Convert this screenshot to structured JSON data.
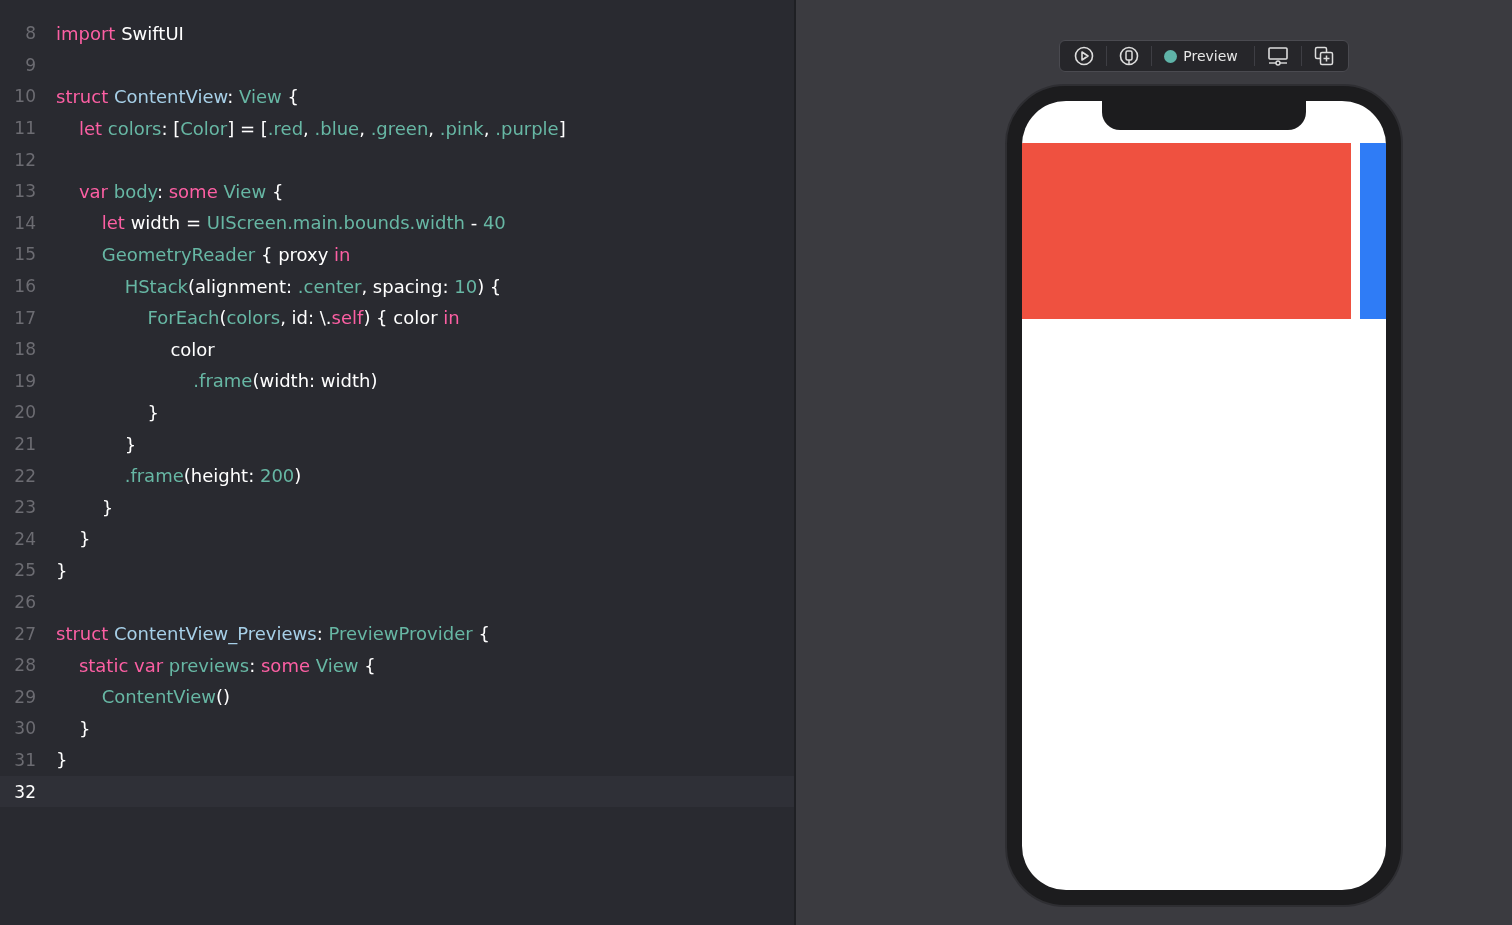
{
  "editor": {
    "lines": [
      {
        "number": "8",
        "current": false,
        "tokens": [
          {
            "kind": "keyword",
            "text": "import"
          },
          {
            "kind": "plain",
            "text": " SwiftUI"
          }
        ]
      },
      {
        "number": "9",
        "current": false
      },
      {
        "number": "10",
        "current": false,
        "tokens": [
          {
            "kind": "keyword",
            "text": "struct "
          },
          {
            "kind": "decl",
            "text": "ContentView"
          },
          {
            "kind": "plain",
            "text": ": "
          },
          {
            "kind": "type",
            "text": "View"
          },
          {
            "kind": "plain",
            "text": " {"
          }
        ]
      },
      {
        "number": "11",
        "current": false,
        "tokens": [
          {
            "kind": "keyword",
            "text": "    let "
          },
          {
            "kind": "type",
            "text": "colors"
          },
          {
            "kind": "plain",
            "text": ": ["
          },
          {
            "kind": "type",
            "text": "Color"
          },
          {
            "kind": "plain",
            "text": "] = ["
          },
          {
            "kind": "type",
            "text": ".red"
          },
          {
            "kind": "plain",
            "text": ", "
          },
          {
            "kind": "type",
            "text": ".blue"
          },
          {
            "kind": "plain",
            "text": ", "
          },
          {
            "kind": "type",
            "text": ".green"
          },
          {
            "kind": "plain",
            "text": ", "
          },
          {
            "kind": "type",
            "text": ".pink"
          },
          {
            "kind": "plain",
            "text": ", "
          },
          {
            "kind": "type",
            "text": ".purple"
          },
          {
            "kind": "plain",
            "text": "]"
          }
        ]
      },
      {
        "number": "12",
        "current": false
      },
      {
        "number": "13",
        "current": false,
        "tokens": [
          {
            "kind": "keyword",
            "text": "    var "
          },
          {
            "kind": "type",
            "text": "body"
          },
          {
            "kind": "plain",
            "text": ": "
          },
          {
            "kind": "keyword",
            "text": "some "
          },
          {
            "kind": "type",
            "text": "View"
          },
          {
            "kind": "plain",
            "text": " {"
          }
        ]
      },
      {
        "number": "14",
        "current": false,
        "tokens": [
          {
            "kind": "keyword",
            "text": "        let"
          },
          {
            "kind": "plain",
            "text": " width = "
          },
          {
            "kind": "type",
            "text": "UIScreen.main.bounds.width"
          },
          {
            "kind": "plain",
            "text": " - "
          },
          {
            "kind": "number",
            "text": "40"
          }
        ]
      },
      {
        "number": "15",
        "current": false,
        "tokens": [
          {
            "kind": "type",
            "text": "        GeometryReader"
          },
          {
            "kind": "plain",
            "text": " { proxy "
          },
          {
            "kind": "keyword",
            "text": "in"
          }
        ]
      },
      {
        "number": "16",
        "current": false,
        "tokens": [
          {
            "kind": "type",
            "text": "            HStack"
          },
          {
            "kind": "plain",
            "text": "(alignment: "
          },
          {
            "kind": "type",
            "text": ".center"
          },
          {
            "kind": "plain",
            "text": ", spacing: "
          },
          {
            "kind": "number",
            "text": "10"
          },
          {
            "kind": "plain",
            "text": ") {"
          }
        ]
      },
      {
        "number": "17",
        "current": false,
        "tokens": [
          {
            "kind": "type",
            "text": "                ForEach"
          },
          {
            "kind": "plain",
            "text": "("
          },
          {
            "kind": "type",
            "text": "colors"
          },
          {
            "kind": "plain",
            "text": ", id: \\."
          },
          {
            "kind": "keyword",
            "text": "self"
          },
          {
            "kind": "plain",
            "text": ") { color "
          },
          {
            "kind": "keyword",
            "text": "in"
          }
        ]
      },
      {
        "number": "18",
        "current": false,
        "tokens": [
          {
            "kind": "plain",
            "text": "                    color"
          }
        ]
      },
      {
        "number": "19",
        "current": false,
        "tokens": [
          {
            "kind": "type",
            "text": "                        .frame"
          },
          {
            "kind": "plain",
            "text": "(width: width)"
          }
        ]
      },
      {
        "number": "20",
        "current": false,
        "tokens": [
          {
            "kind": "plain",
            "text": "                }"
          }
        ]
      },
      {
        "number": "21",
        "current": false,
        "tokens": [
          {
            "kind": "plain",
            "text": "            }"
          }
        ]
      },
      {
        "number": "22",
        "current": false,
        "tokens": [
          {
            "kind": "type",
            "text": "            .frame"
          },
          {
            "kind": "plain",
            "text": "(height: "
          },
          {
            "kind": "number",
            "text": "200"
          },
          {
            "kind": "plain",
            "text": ")"
          }
        ]
      },
      {
        "number": "23",
        "current": false,
        "tokens": [
          {
            "kind": "plain",
            "text": "        }"
          }
        ]
      },
      {
        "number": "24",
        "current": false,
        "tokens": [
          {
            "kind": "plain",
            "text": "    }"
          }
        ]
      },
      {
        "number": "25",
        "current": false,
        "tokens": [
          {
            "kind": "plain",
            "text": "}"
          }
        ]
      },
      {
        "number": "26",
        "current": false
      },
      {
        "number": "27",
        "current": false,
        "tokens": [
          {
            "kind": "keyword",
            "text": "struct "
          },
          {
            "kind": "decl",
            "text": "ContentView_Previews"
          },
          {
            "kind": "plain",
            "text": ": "
          },
          {
            "kind": "type",
            "text": "PreviewProvider"
          },
          {
            "kind": "plain",
            "text": " {"
          }
        ]
      },
      {
        "number": "28",
        "current": false,
        "tokens": [
          {
            "kind": "keyword",
            "text": "    static var "
          },
          {
            "kind": "type",
            "text": "previews"
          },
          {
            "kind": "plain",
            "text": ": "
          },
          {
            "kind": "keyword",
            "text": "some "
          },
          {
            "kind": "type",
            "text": "View"
          },
          {
            "kind": "plain",
            "text": " {"
          }
        ]
      },
      {
        "number": "29",
        "current": false,
        "tokens": [
          {
            "kind": "type",
            "text": "        ContentView"
          },
          {
            "kind": "plain",
            "text": "()"
          }
        ]
      },
      {
        "number": "30",
        "current": false,
        "tokens": [
          {
            "kind": "plain",
            "text": "    }"
          }
        ]
      },
      {
        "number": "31",
        "current": false,
        "tokens": [
          {
            "kind": "plain",
            "text": "}"
          }
        ]
      },
      {
        "number": "32",
        "current": true
      }
    ]
  },
  "preview": {
    "toolbar": {
      "label": "Preview"
    },
    "swatches": [
      {
        "color": "#ef5140"
      },
      {
        "color": "#2f7cf6"
      }
    ]
  }
}
